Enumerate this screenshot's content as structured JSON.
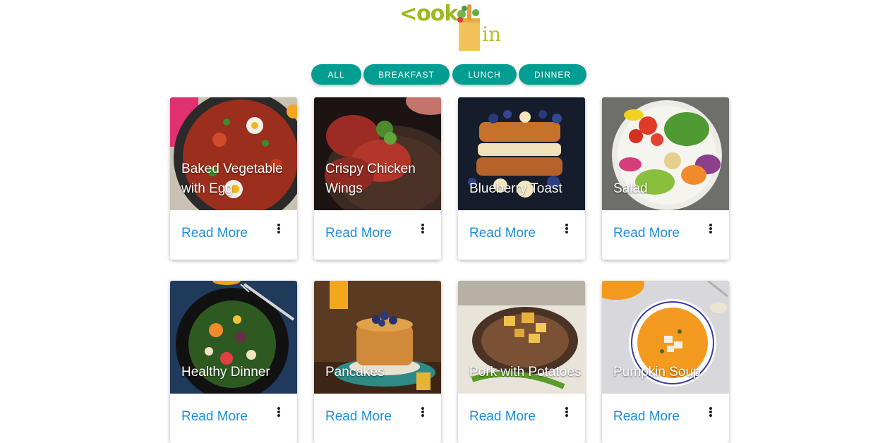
{
  "logo": {
    "text_left": "<ook",
    "text_right": "in"
  },
  "filters": [
    {
      "label": "ALL"
    },
    {
      "label": "BREAKFAST"
    },
    {
      "label": "LUNCH"
    },
    {
      "label": "DINNER"
    }
  ],
  "colors": {
    "accent": "#009e92",
    "link": "#1a8fe0",
    "logo": "#9fb71e"
  },
  "recipes": [
    {
      "title": "Baked Vegetable with Egg",
      "action": "Read More"
    },
    {
      "title": "Crispy Chicken Wings",
      "action": "Read More"
    },
    {
      "title": "Blueberry Toast",
      "action": "Read More"
    },
    {
      "title": "Salad",
      "action": "Read More"
    },
    {
      "title": "Healthy Dinner",
      "action": "Read More"
    },
    {
      "title": "Pancakes",
      "action": "Read More"
    },
    {
      "title": "Pork with Potatoes",
      "action": "Read More"
    },
    {
      "title": "Pumpkin Soup",
      "action": "Read More"
    }
  ]
}
